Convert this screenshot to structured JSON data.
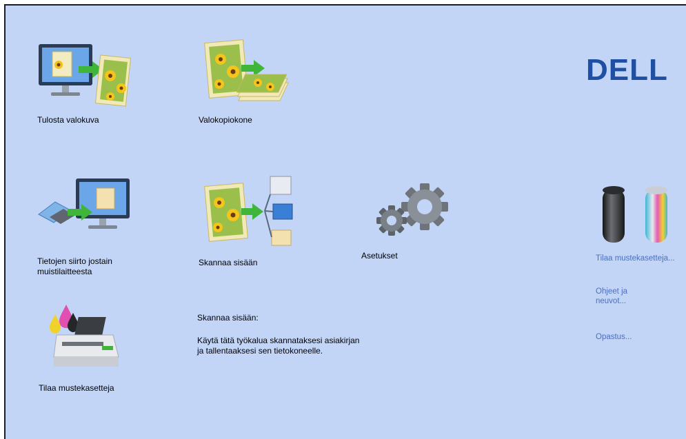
{
  "brand": {
    "logo_text": "DELL"
  },
  "tiles": {
    "print_photo": {
      "label": "Tulosta valokuva",
      "icon": "monitor-photo-print-icon"
    },
    "copier": {
      "label": "Valokopiokone",
      "icon": "photo-copy-icon"
    },
    "transfer": {
      "label": "Tietojen siirto jostain muistilaitteesta",
      "icon": "memory-card-transfer-icon"
    },
    "scan": {
      "label": "Skannaa sisään",
      "icon": "scan-to-computer-icon"
    },
    "settings": {
      "label": "Asetukset",
      "icon": "gears-icon"
    },
    "order_ink": {
      "label": "Tilaa mustekasetteja",
      "icon": "printer-ink-icon"
    }
  },
  "info_panel": {
    "title": "Skannaa sisään:",
    "description": "Käytä tätä työkalua skannataksesi asiakirjan ja tallentaaksesi sen tietokoneelle."
  },
  "side_links": {
    "order_cartridges": "Tilaa mustekasetteja...",
    "help": "Ohjeet ja neuvot...",
    "tutorial": "Opastus..."
  },
  "colors": {
    "background": "#c2d5f7",
    "link": "#4a6fbd",
    "brand": "#1f4fa3"
  }
}
